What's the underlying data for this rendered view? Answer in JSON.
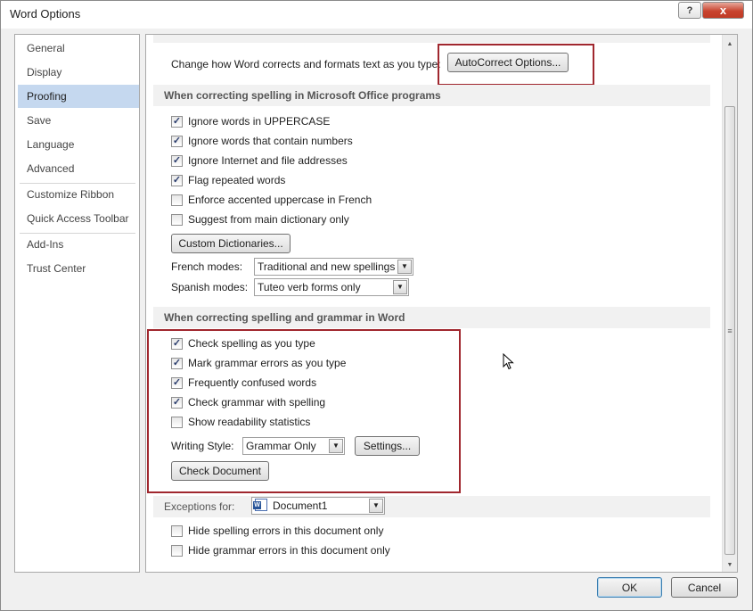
{
  "window": {
    "title": "Word Options",
    "help_label": "?",
    "close_label": "x"
  },
  "nav": {
    "items": [
      {
        "label": "General"
      },
      {
        "label": "Display"
      },
      {
        "label": "Proofing"
      },
      {
        "label": "Save"
      },
      {
        "label": "Language"
      },
      {
        "label": "Advanced"
      },
      {
        "label": "Customize Ribbon"
      },
      {
        "label": "Quick Access Toolbar"
      },
      {
        "label": "Add-Ins"
      },
      {
        "label": "Trust Center"
      }
    ],
    "active": "Proofing"
  },
  "autocorrect": {
    "text": "Change how Word corrects and formats text as you type:",
    "button": "AutoCorrect Options..."
  },
  "office_section": {
    "header": "When correcting spelling in Microsoft Office programs",
    "checks": [
      {
        "label": "Ignore words in UPPERCASE",
        "checked": true
      },
      {
        "label": "Ignore words that contain numbers",
        "checked": true
      },
      {
        "label": "Ignore Internet and file addresses",
        "checked": true
      },
      {
        "label": "Flag repeated words",
        "checked": true
      },
      {
        "label": "Enforce accented uppercase in French",
        "checked": false
      },
      {
        "label": "Suggest from main dictionary only",
        "checked": false
      }
    ],
    "custom_dict_button": "Custom Dictionaries...",
    "french_label": "French modes:",
    "french_value": "Traditional and new spellings",
    "spanish_label": "Spanish modes:",
    "spanish_value": "Tuteo verb forms only"
  },
  "word_section": {
    "header": "When correcting spelling and grammar in Word",
    "checks": [
      {
        "label": "Check spelling as you type",
        "checked": true
      },
      {
        "label": "Mark grammar errors as you type",
        "checked": true
      },
      {
        "label": "Frequently confused words",
        "checked": true
      },
      {
        "label": "Check grammar with spelling",
        "checked": true
      },
      {
        "label": "Show readability statistics",
        "checked": false
      }
    ],
    "writing_style_label": "Writing Style:",
    "writing_style_value": "Grammar Only",
    "settings_button": "Settings...",
    "check_document_button": "Check Document"
  },
  "exceptions": {
    "label": "Exceptions for:",
    "document": "Document1",
    "checks": [
      {
        "label": "Hide spelling errors in this document only",
        "checked": false
      },
      {
        "label": "Hide grammar errors in this document only",
        "checked": false
      }
    ]
  },
  "footer": {
    "ok": "OK",
    "cancel": "Cancel"
  },
  "colors": {
    "highlight_box": "#a0272e",
    "nav_active": "#c5d8ef",
    "section_header_bg": "#f1f1f1"
  }
}
